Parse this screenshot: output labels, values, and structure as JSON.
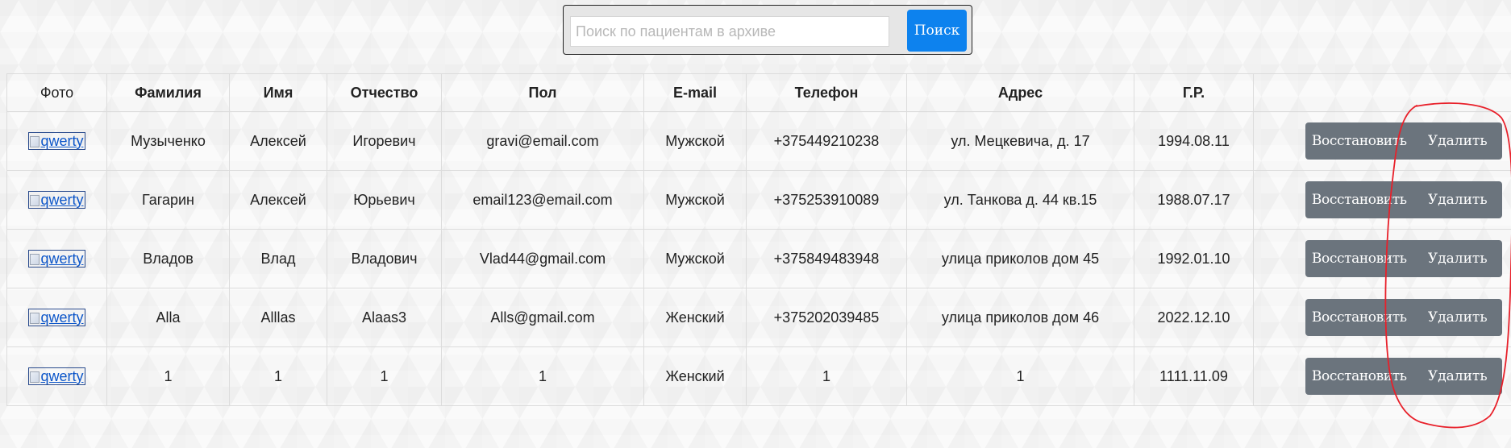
{
  "search": {
    "placeholder": "Поиск по пациентам в архиве",
    "value": "",
    "button_label": "Поиск"
  },
  "table": {
    "headers": {
      "photo": "Фото",
      "last_name": "Фамилия",
      "first_name": "Имя",
      "patronymic": "Отчество",
      "col4": "Пол",
      "col5": "E-mail",
      "phone": "Телефон",
      "address": "Адрес",
      "birth": "Г.Р.",
      "actions": ""
    },
    "rows": [
      {
        "photo_alt": "qwerty",
        "last_name": "Музыченко",
        "first_name": "Алексей",
        "patronymic": "Игоревич",
        "col4": "gravi@email.com",
        "col5": "Мужской",
        "phone": "+375449210238",
        "address": "ул. Мецкевича, д. 17",
        "birth": "1994.08.11",
        "restore_label": "Восстановить",
        "delete_label": "Удалить"
      },
      {
        "photo_alt": "qwerty",
        "last_name": "Гагарин",
        "first_name": "Алексей",
        "patronymic": "Юрьевич",
        "col4": "email123@email.com",
        "col5": "Мужской",
        "phone": "+375253910089",
        "address": "ул. Танкова д. 44 кв.15",
        "birth": "1988.07.17",
        "restore_label": "Восстановить",
        "delete_label": "Удалить"
      },
      {
        "photo_alt": "qwerty",
        "last_name": "Владов",
        "first_name": "Влад",
        "patronymic": "Владович",
        "col4": "Vlad44@gmail.com",
        "col5": "Мужской",
        "phone": "+375849483948",
        "address": "улица приколов дом 45",
        "birth": "1992.01.10",
        "restore_label": "Восстановить",
        "delete_label": "Удалить"
      },
      {
        "photo_alt": "qwerty",
        "last_name": "Alla",
        "first_name": "Alllas",
        "patronymic": "Alaas3",
        "col4": "Alls@gmail.com",
        "col5": "Женский",
        "phone": "+375202039485",
        "address": "улица приколов дом 46",
        "birth": "2022.12.10",
        "restore_label": "Восстановить",
        "delete_label": "Удалить"
      },
      {
        "photo_alt": "qwerty",
        "last_name": "1",
        "first_name": "1",
        "patronymic": "1",
        "col4": "1",
        "col5": "Женский",
        "phone": "1",
        "address": "1",
        "birth": "1111.11.09",
        "restore_label": "Восстановить",
        "delete_label": "Удалить"
      }
    ]
  },
  "colors": {
    "primary_button": "#0d82ee",
    "secondary_button": "#6b747d",
    "annotation_red": "#e8202a",
    "link": "#0b55c9"
  },
  "icons": {
    "broken_image": "broken-image-icon"
  }
}
